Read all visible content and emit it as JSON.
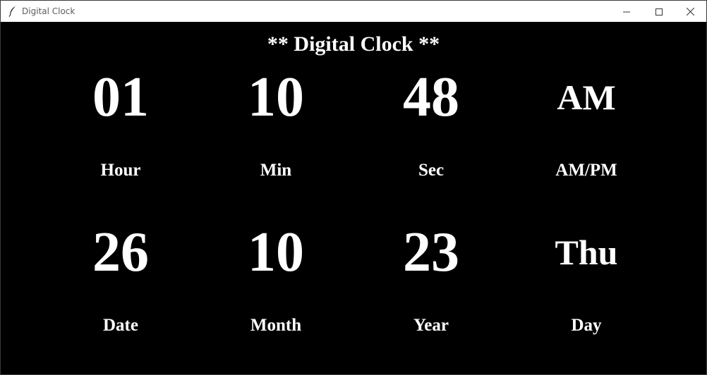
{
  "window": {
    "title": "Digital Clock",
    "controls": {
      "minimize": "minimize-icon",
      "maximize": "maximize-icon",
      "close": "close-icon"
    }
  },
  "heading": "** Digital Clock **",
  "time": {
    "hour": "01",
    "minute": "10",
    "second": "48",
    "ampm": "AM"
  },
  "date": {
    "day_of_month": "26",
    "month": "10",
    "year": "23",
    "weekday": "Thu"
  },
  "labels": {
    "hour": "Hour",
    "minute": "Min",
    "second": "Sec",
    "ampm": "AM/PM",
    "date": "Date",
    "month": "Month",
    "year": "Year",
    "day": "Day"
  },
  "colors": {
    "background": "#000000",
    "text": "#ffffff",
    "titlebar": "#ffffff"
  }
}
